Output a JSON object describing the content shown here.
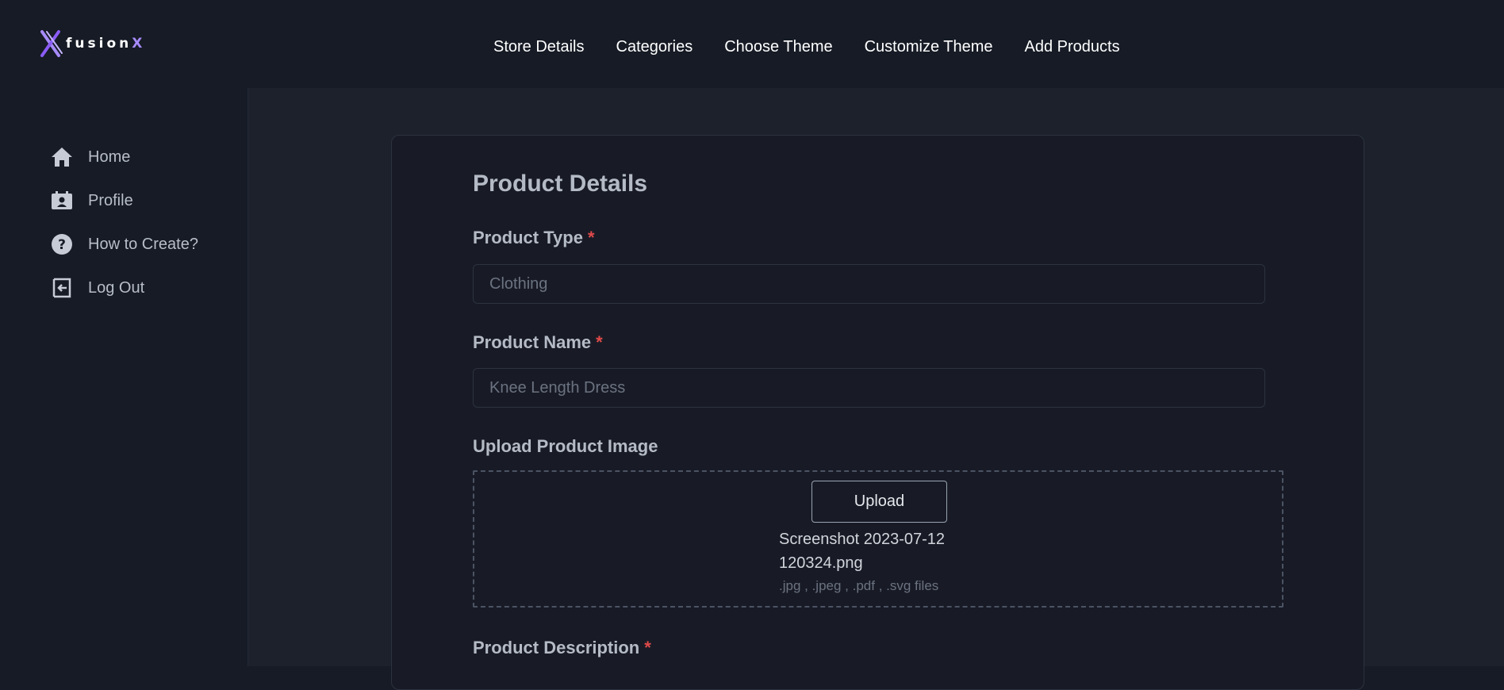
{
  "brand": {
    "logo_text_main": "fusion",
    "logo_text_accent": "X",
    "accent_color": "#a78bfa"
  },
  "nav": {
    "items": [
      {
        "label": "Store Details"
      },
      {
        "label": "Categories"
      },
      {
        "label": "Choose Theme"
      },
      {
        "label": "Customize Theme"
      },
      {
        "label": "Add Products"
      }
    ]
  },
  "sidebar": {
    "items": [
      {
        "label": "Home",
        "icon": "home-icon"
      },
      {
        "label": "Profile",
        "icon": "profile-icon"
      },
      {
        "label": "How to Create?",
        "icon": "help-icon"
      },
      {
        "label": "Log Out",
        "icon": "logout-icon"
      }
    ]
  },
  "form": {
    "title": "Product Details",
    "required_marker": "*",
    "product_type": {
      "label": "Product Type",
      "placeholder": "Clothing"
    },
    "product_name": {
      "label": "Product Name",
      "placeholder": "Knee Length Dress"
    },
    "upload": {
      "label": "Upload Product Image",
      "button_label": "Upload",
      "file_name": "Screenshot 2023-07-12 120324.png",
      "hint": ".jpg , .jpeg , .pdf , .svg files"
    },
    "product_description": {
      "label": "Product Description"
    }
  }
}
